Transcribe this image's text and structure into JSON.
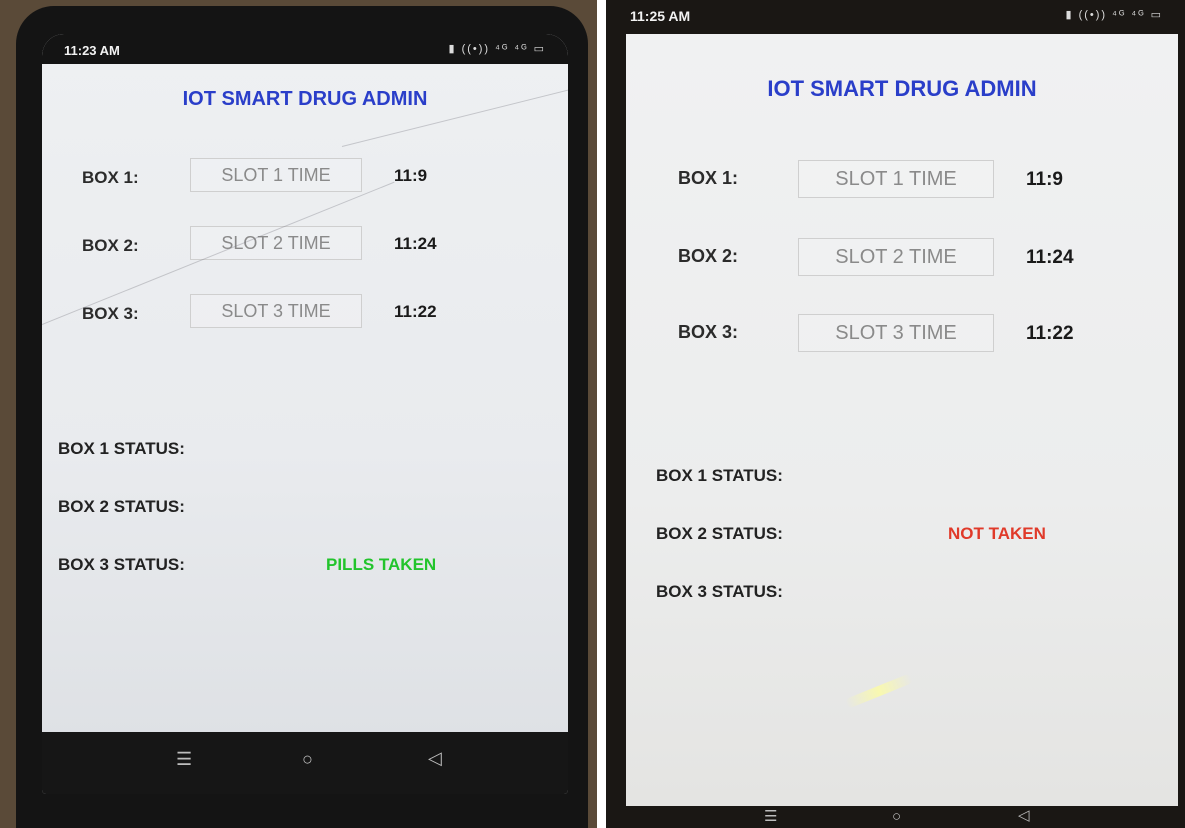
{
  "screens": [
    {
      "status_bar": {
        "time": "11:23 AM",
        "icons": "▮ ((•)) ⁴ᴳ ⁴ᴳ ▭"
      },
      "title": "IOT SMART DRUG ADMIN",
      "boxes": [
        {
          "label": "BOX 1:",
          "slot_placeholder": "SLOT 1 TIME",
          "time": "11:9"
        },
        {
          "label": "BOX 2:",
          "slot_placeholder": "SLOT 2 TIME",
          "time": "11:24"
        },
        {
          "label": "BOX 3:",
          "slot_placeholder": "SLOT 3 TIME",
          "time": "11:22"
        }
      ],
      "statuses": [
        {
          "label": "BOX 1 STATUS:",
          "value": ""
        },
        {
          "label": "BOX 2 STATUS:",
          "value": ""
        },
        {
          "label": "BOX 3 STATUS:",
          "value": "PILLS TAKEN",
          "color": "#22c42c"
        }
      ],
      "nav": {
        "menu_icon": "menu-icon",
        "home_icon": "home-icon",
        "back_icon": "back-icon"
      }
    },
    {
      "status_bar": {
        "time": "11:25 AM",
        "icons": "▮ ((•)) ⁴ᴳ ⁴ᴳ ▭"
      },
      "title": "IOT SMART DRUG ADMIN",
      "boxes": [
        {
          "label": "BOX 1:",
          "slot_placeholder": "SLOT 1 TIME",
          "time": "11:9"
        },
        {
          "label": "BOX 2:",
          "slot_placeholder": "SLOT 2 TIME",
          "time": "11:24"
        },
        {
          "label": "BOX 3:",
          "slot_placeholder": "SLOT 3 TIME",
          "time": "11:22"
        }
      ],
      "statuses": [
        {
          "label": "BOX 1 STATUS:",
          "value": ""
        },
        {
          "label": "BOX 2 STATUS:",
          "value": "NOT TAKEN",
          "color": "#e03a2a"
        },
        {
          "label": "BOX 3 STATUS:",
          "value": ""
        }
      ],
      "nav": {
        "menu_icon": "menu-icon",
        "home_icon": "home-icon",
        "back_icon": "back-icon"
      }
    }
  ],
  "colors": {
    "title": "#2a3ec9",
    "taken": "#22c42c",
    "not_taken": "#e03a2a"
  }
}
